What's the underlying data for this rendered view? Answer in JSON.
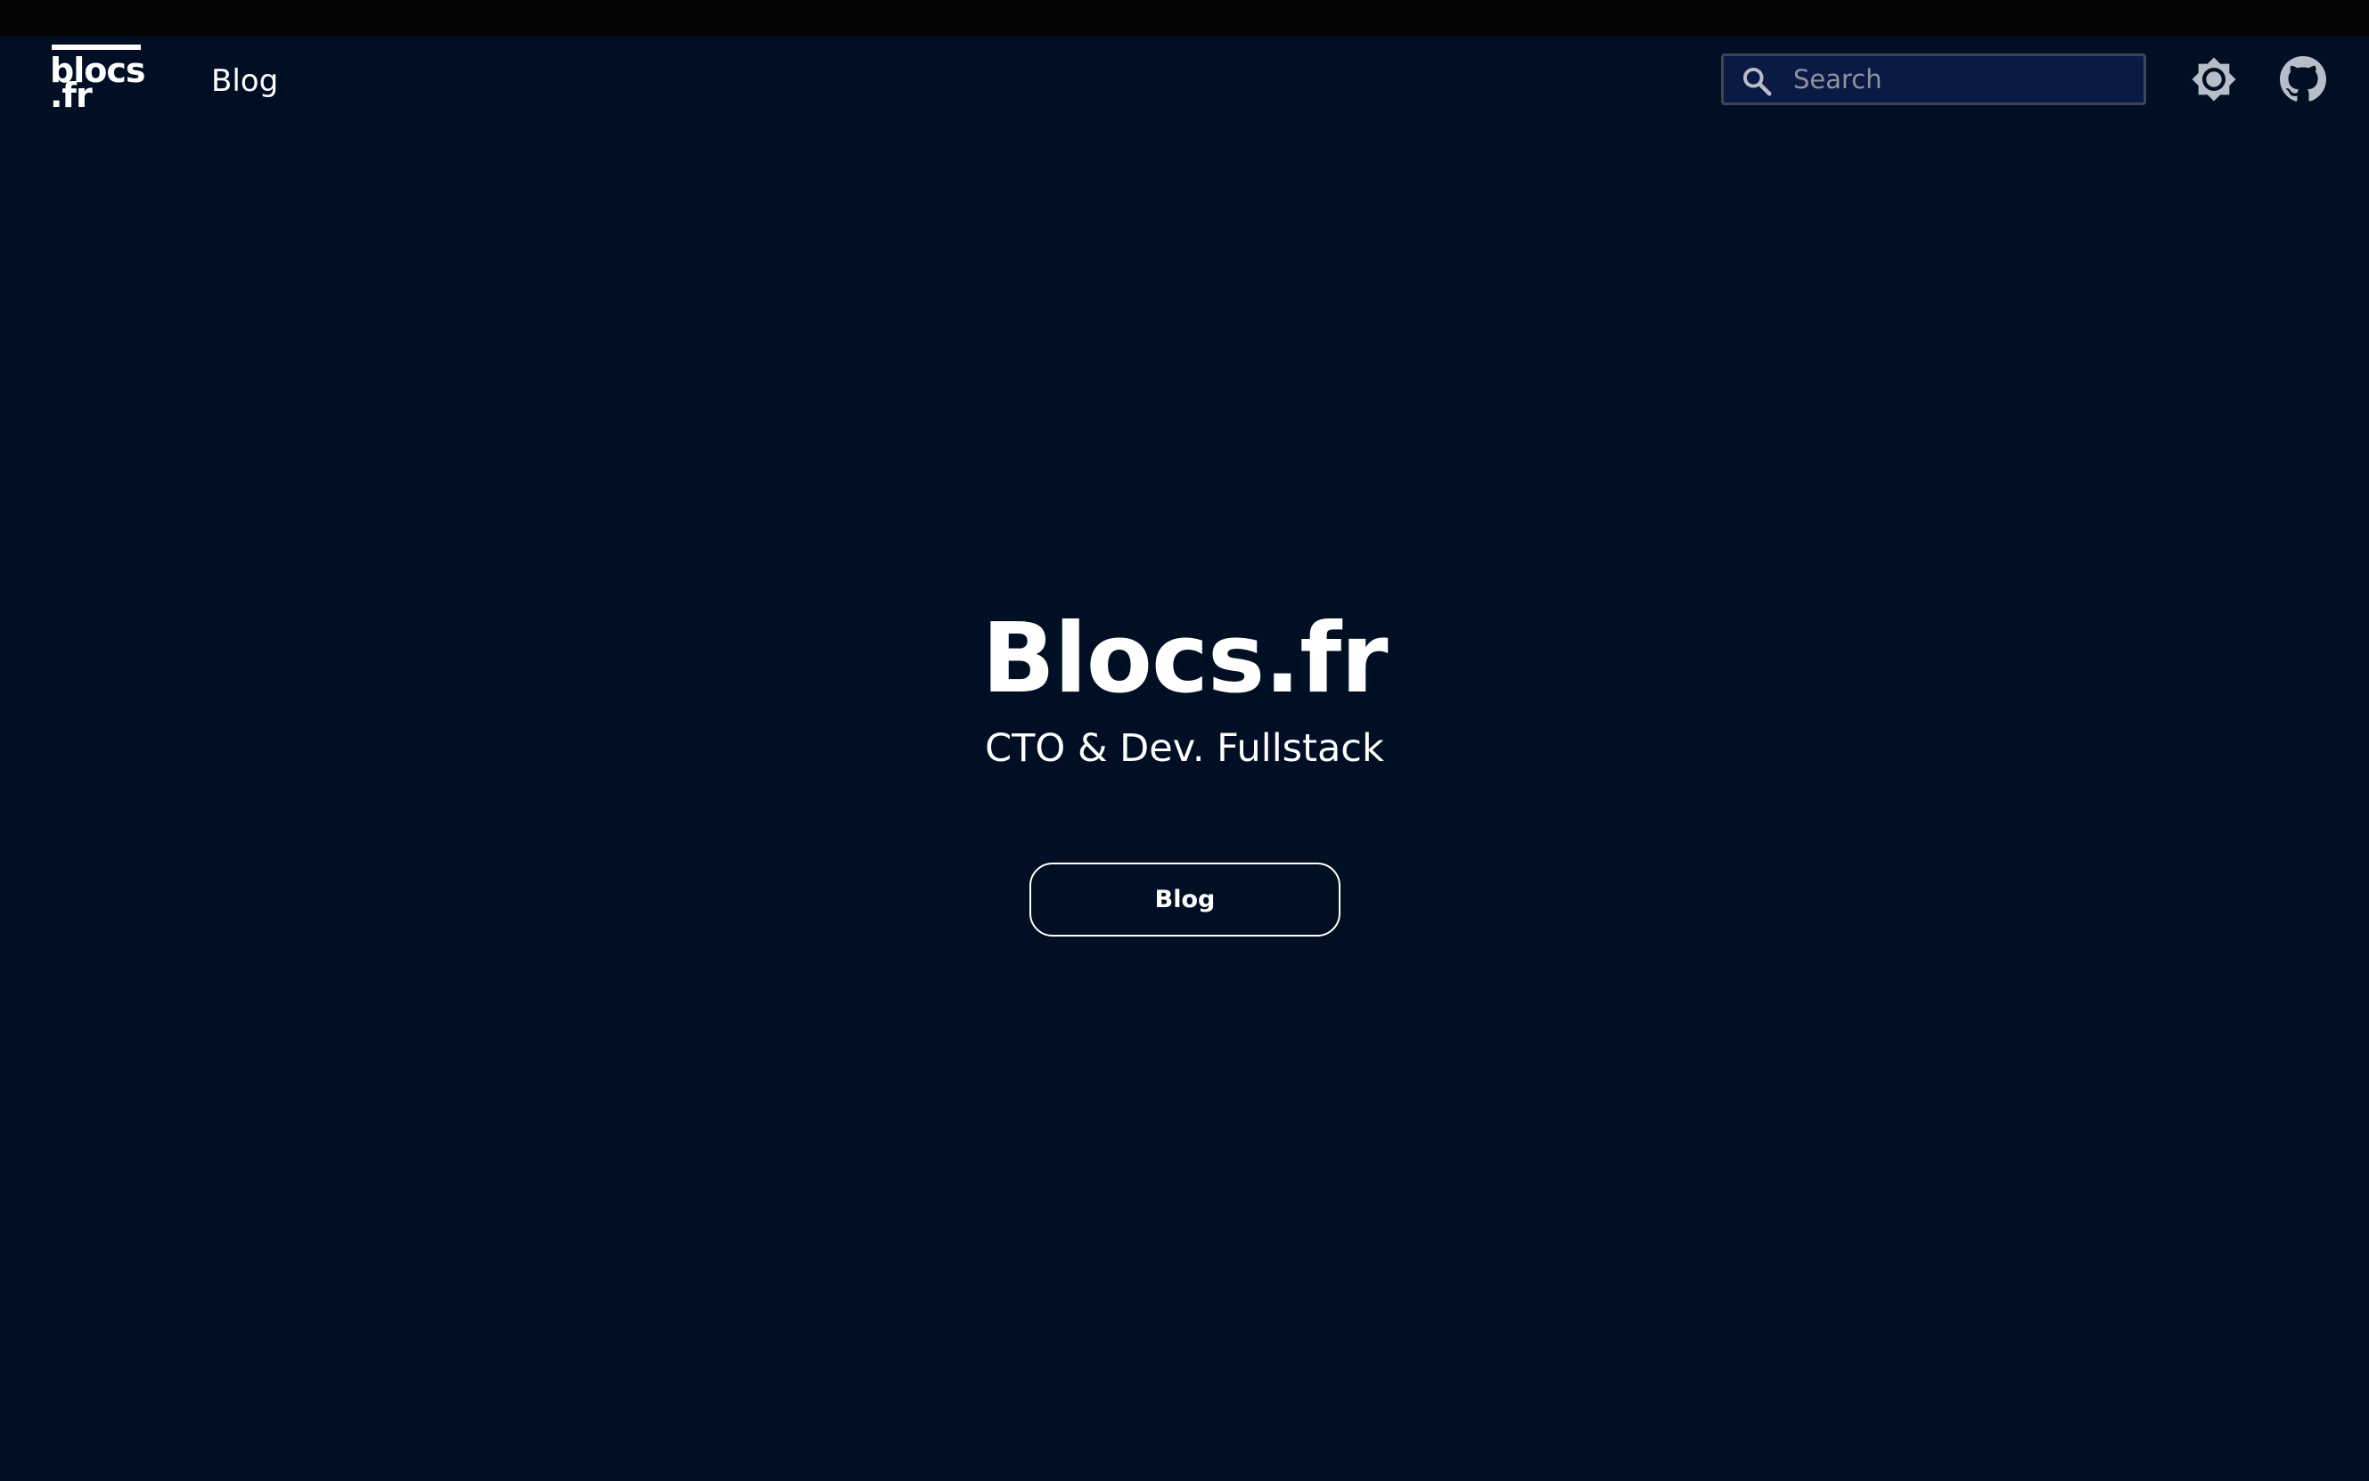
{
  "header": {
    "logo": {
      "line1": "blocs",
      "line2": ".fr"
    },
    "nav": {
      "blog_label": "Blog"
    },
    "search": {
      "placeholder": "Search",
      "value": ""
    },
    "icons": {
      "search": "search-icon",
      "theme_toggle": "sun-icon",
      "github": "github-icon"
    }
  },
  "hero": {
    "title": "Blocs.fr",
    "subtitle": "CTO & Dev. Fullstack",
    "button_label": "Blog"
  },
  "colors": {
    "background": "#000f24",
    "top_strip": "#050505",
    "search_background": "#0a1a44",
    "search_border": "#3d4656",
    "text": "#ffffff",
    "placeholder": "#8b92a0",
    "icon": "#b8bec8"
  }
}
